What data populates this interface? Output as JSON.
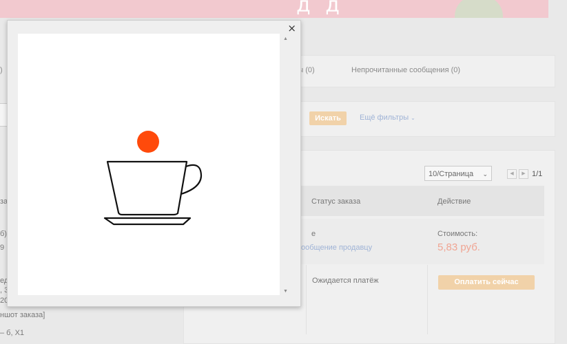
{
  "banner": {
    "glyphs": "д д"
  },
  "tabs": {
    "disputes": "оры (0)",
    "unread": "Непрочитанные сообщения (0)",
    "left_fragment": ")"
  },
  "filters": {
    "search_label": "Искать",
    "more_filters": "Ещё фильтры"
  },
  "pagination": {
    "per_page": "10/Страница",
    "prev": "◀",
    "next": "▶",
    "page": "1/1"
  },
  "table": {
    "col_status": "Статус заказа",
    "col_action": "Действие",
    "row1": {
      "fragment_e": "е",
      "contact_seller": "ообщение продавцу",
      "cost_label": "Стоимость:",
      "cost_value": "5,83 руб."
    },
    "row2": {
      "status": "Ожидается платёж",
      "pay_button": "Оплатить сейчас"
    }
  },
  "left_fragments": {
    "a": "за",
    "b": "б)",
    "c": "9 |",
    "d": "ед",
    "e": ", 3",
    "f": "20",
    "g": "ншот заказа]",
    "h": "– б, Х1"
  },
  "modal": {
    "close": "×",
    "scroll_up": "▲",
    "scroll_down": "▼"
  },
  "colors": {
    "dot": "#ff4a0b",
    "accent_button": "#f1d2a9",
    "price": "#f0a593",
    "link": "#9fb3d6"
  },
  "icons": {
    "close": "close-icon",
    "illustration": "coffee-cup-icon",
    "dropdown": "chevron-down-icon"
  }
}
